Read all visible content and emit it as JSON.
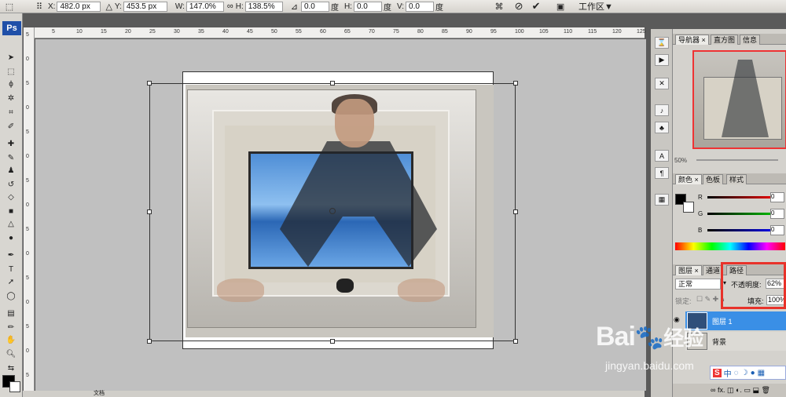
{
  "options_bar": {
    "x_label": "X:",
    "x_value": "482.0 px",
    "y_label": "Y:",
    "y_value": "453.5 px",
    "w_label": "W:",
    "w_value": "147.0%",
    "h_label": "H:",
    "h_value": "138.5%",
    "rot_value": "0.0",
    "rot_unit": "度",
    "hskew_label": "H:",
    "hskew_value": "0.0",
    "hskew_unit": "度",
    "vskew_label": "V:",
    "vskew_value": "0.0",
    "vskew_unit": "度",
    "workspace_label": "工作区▼"
  },
  "app_logo": "Ps",
  "ruler": {
    "h_ticks": [
      "5",
      "10",
      "15",
      "20",
      "25",
      "30",
      "35",
      "40",
      "45",
      "50",
      "55",
      "60",
      "65",
      "70",
      "75",
      "80",
      "85",
      "90",
      "95",
      "100",
      "105",
      "110",
      "115",
      "120",
      "125"
    ],
    "v_ticks": [
      "5",
      "0",
      "5",
      "0",
      "5",
      "0",
      "5",
      "0",
      "5",
      "0",
      "5",
      "0",
      "5",
      "0",
      "5"
    ]
  },
  "navigator_panel": {
    "tabs": [
      "导航器",
      "直方图",
      "信息"
    ],
    "zoom": "50%"
  },
  "color_panel": {
    "tabs": [
      "颜色",
      "色板",
      "样式"
    ],
    "r_label": "R",
    "g_label": "G",
    "b_label": "B",
    "r_value": "0",
    "g_value": "0",
    "b_value": "0"
  },
  "layers_panel": {
    "tabs": [
      "图层",
      "通道",
      "路径"
    ],
    "blend_mode": "正常",
    "opacity_label": "不透明度:",
    "opacity_value": "62%",
    "lock_label": "锁定:",
    "fill_label": "填充:",
    "fill_value": "100%",
    "layer1_name": "图层 1",
    "layer2_name": "背景"
  },
  "watermark": {
    "brand": "Bai",
    "brand2": "经验",
    "url": "jingyan.baidu.com"
  },
  "status": {
    "doc_label": "文档"
  },
  "colors": {
    "highlight": "#e8322a",
    "layer_selected": "#3a8fe6",
    "ps_blue": "#1f4fa8"
  }
}
